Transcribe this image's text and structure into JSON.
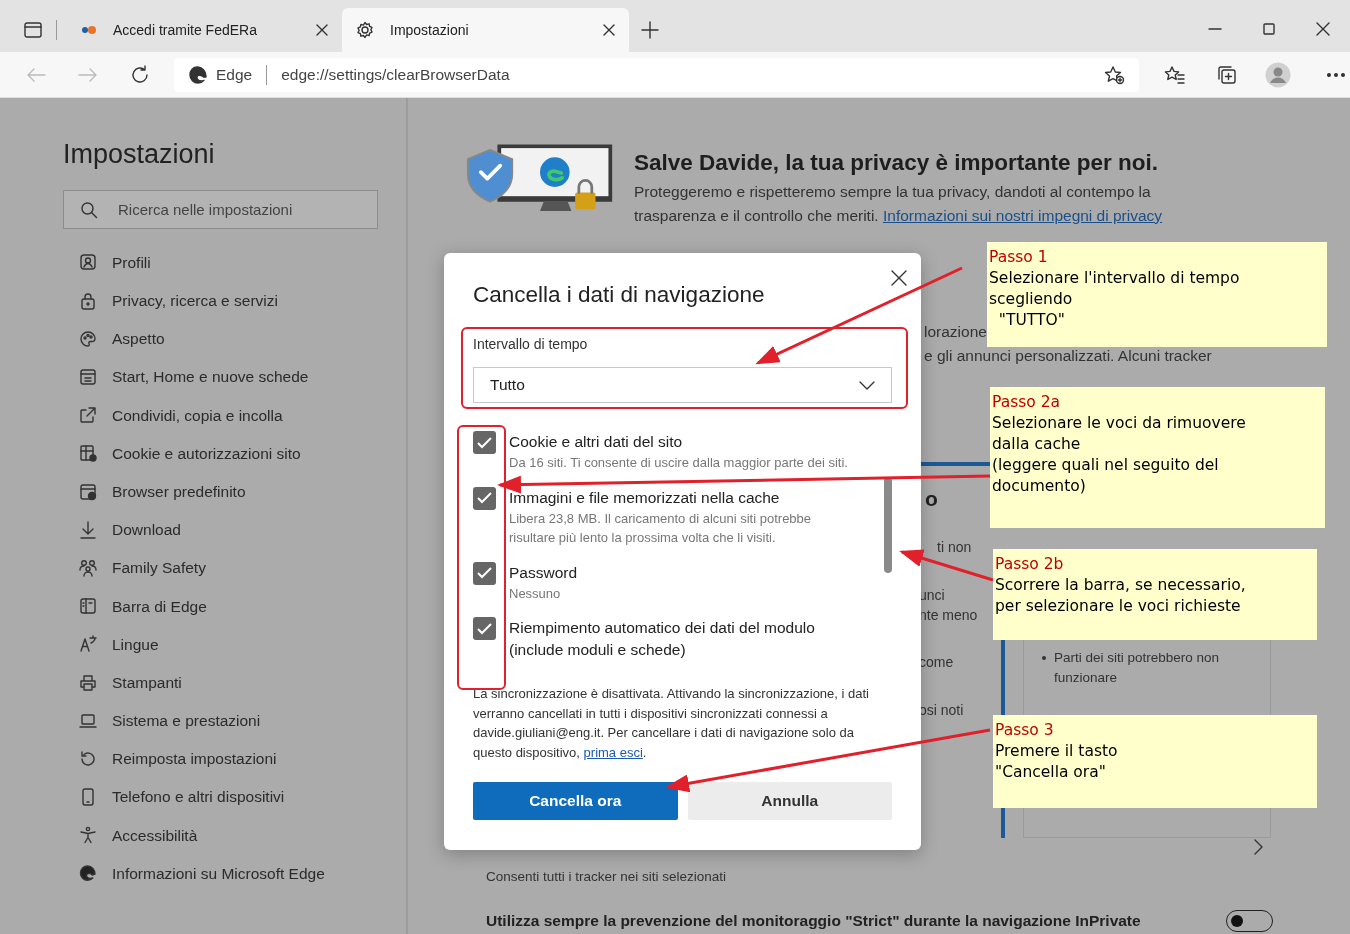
{
  "browser": {
    "tabs": [
      {
        "title": "Accedi tramite FedERa",
        "selected": false
      },
      {
        "title": "Impostazioni",
        "selected": true
      }
    ],
    "address": {
      "site_label": "Edge",
      "url": "edge://settings/clearBrowserData"
    }
  },
  "sidebar": {
    "title": "Impostazioni",
    "search": {
      "placeholder": "Ricerca nelle impostazioni"
    },
    "items": [
      {
        "label": "Profili"
      },
      {
        "label": "Privacy, ricerca e servizi"
      },
      {
        "label": "Aspetto"
      },
      {
        "label": "Start, Home e nuove schede"
      },
      {
        "label": "Condividi, copia e incolla"
      },
      {
        "label": "Cookie e autorizzazioni sito"
      },
      {
        "label": "Browser predefinito"
      },
      {
        "label": "Download"
      },
      {
        "label": "Family Safety"
      },
      {
        "label": "Barra di Edge"
      },
      {
        "label": "Lingue"
      },
      {
        "label": "Stampanti"
      },
      {
        "label": "Sistema e prestazioni"
      },
      {
        "label": "Reimposta impostazioni"
      },
      {
        "label": "Telefono e altri dispositivi"
      },
      {
        "label": "Accessibilità"
      },
      {
        "label": "Informazioni su Microsoft Edge"
      }
    ]
  },
  "content": {
    "heading": "Salve Davide, la tua privacy è importante per noi.",
    "intro": "Proteggeremo e rispetteremo sempre la tua privacy, dandoti al contempo la trasparenza e il controllo che meriti.",
    "intro_link": "Informazioni sui nostri impegni di privacy",
    "fragment_lines": [
      "lorazione",
      "e gli annunci personalizzati. Alcuni tracker"
    ],
    "fragment_heading": "o",
    "fragments": [
      "ti non",
      "unci",
      "nte meno",
      "come",
      "osi noti"
    ],
    "bullet": "Parti dei siti potrebbero non funzionare",
    "exceptions_desc": "Consenti tutti i tracker nei siti selezionati",
    "strict_inprivate": {
      "label": "Utilizza sempre la prevenzione del monitoraggio \"Strict\" durante la navigazione InPrivate",
      "on": false
    }
  },
  "dialog": {
    "title": "Cancella i dati di navigazione",
    "time_range": {
      "label": "Intervallo di tempo",
      "value": "Tutto"
    },
    "items": [
      {
        "title": "Cookie e altri dati del sito",
        "description": "Da 16 siti. Ti consente di uscire dalla maggior parte dei siti.",
        "checked": true
      },
      {
        "title": "Immagini e file memorizzati nella cache",
        "description": "Libera 23,8 MB. Il caricamento di alcuni siti potrebbe risultare più lento la prossima volta che li visiti.",
        "checked": true
      },
      {
        "title": "Password",
        "description": "Nessuno",
        "checked": true
      },
      {
        "title": "Riempimento automatico dei dati del modulo (include moduli e schede)",
        "checked": true
      }
    ],
    "sync_note": "La sincronizzazione è disattivata. Attivando la sincronizzazione, i dati verranno cancellati in tutti i dispositivi sincronizzati connessi a davide.giuliani@eng.it. Per cancellare i dati di navigazione solo da questo dispositivo, ",
    "sync_link": "prima esci",
    "sync_after": ".",
    "buttons": [
      {
        "label": "Cancella ora",
        "kind": "primary"
      },
      {
        "label": "Annulla",
        "kind": "secondary"
      }
    ]
  },
  "annotations": [
    {
      "step": "Passo 1",
      "text": "Selezionare l'intervallo di tempo\nscegliendo\n  \"TUTTO\""
    },
    {
      "step": "Passo 2a",
      "text": "Selezionare le voci da rimuovere\ndalla cache\n(leggere quali nel seguito del\ndocumento)"
    },
    {
      "step": "Passo 2b",
      "text": "Scorrere la barra, se necessario,\nper selezionare le voci richieste"
    },
    {
      "step": "Passo 3",
      "text": "Premere il tasto\n\"Cancella ora\""
    }
  ]
}
